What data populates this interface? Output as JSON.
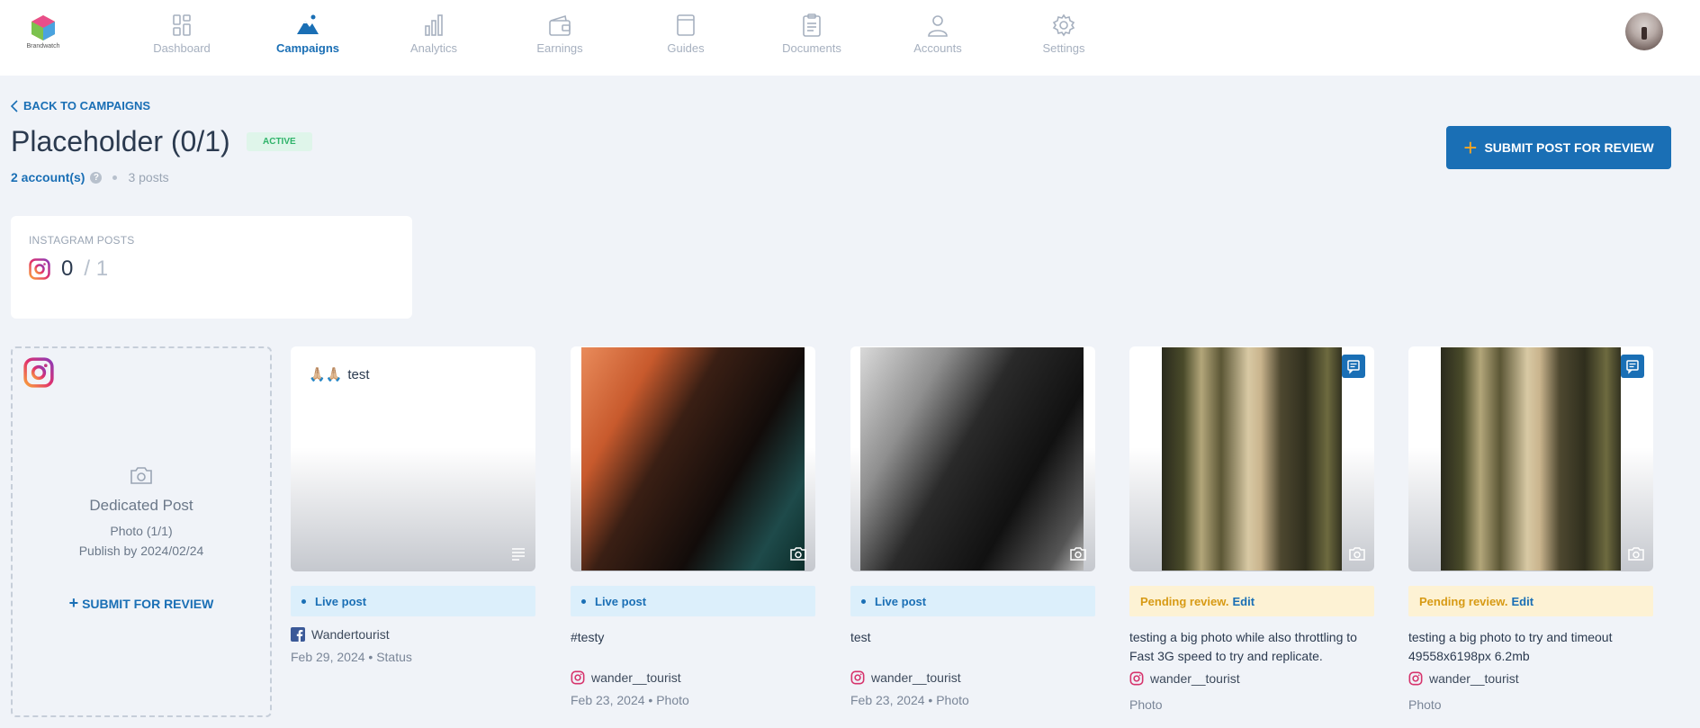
{
  "brand": {
    "logo_text": "Brandwatch"
  },
  "nav": {
    "items": [
      {
        "label": "Dashboard",
        "icon": "dashboard-icon"
      },
      {
        "label": "Campaigns",
        "icon": "mountain-icon",
        "active": true
      },
      {
        "label": "Analytics",
        "icon": "bar-chart-icon"
      },
      {
        "label": "Earnings",
        "icon": "wallet-icon"
      },
      {
        "label": "Guides",
        "icon": "book-icon"
      },
      {
        "label": "Documents",
        "icon": "clipboard-icon"
      },
      {
        "label": "Accounts",
        "icon": "user-icon"
      },
      {
        "label": "Settings",
        "icon": "gear-icon"
      }
    ]
  },
  "header": {
    "back_label": "BACK TO CAMPAIGNS",
    "title": "Placeholder (0/1)",
    "status": "ACTIVE",
    "accounts": "2 account(s)",
    "help": "?",
    "posts_count": "3 posts",
    "submit_label": "SUBMIT POST FOR REVIEW"
  },
  "stats": {
    "label": "INSTAGRAM POSTS",
    "done": "0",
    "total": "/ 1"
  },
  "dedicated": {
    "title": "Dedicated Post",
    "subtitle": "Photo (1/1)",
    "publish_by": "Publish by 2024/02/24",
    "submit_label": "SUBMIT FOR REVIEW"
  },
  "posts": [
    {
      "thumb_text": "test",
      "thumb_emoji": "🙏🏼🙏🏼",
      "status": "Live post",
      "caption": "",
      "account": "Wandertourist",
      "platform": "facebook",
      "date_line": "Feb 29, 2024 • Status"
    },
    {
      "status": "Live post",
      "caption": "#testy",
      "account": "wander__tourist",
      "platform": "instagram",
      "date_line": "Feb 23, 2024 • Photo"
    },
    {
      "status": "Live post",
      "caption": "test",
      "account": "wander__tourist",
      "platform": "instagram",
      "date_line": "Feb 23, 2024 • Photo"
    },
    {
      "status": "Pending review.",
      "edit": "Edit",
      "caption": "testing a big photo while also throttling to Fast 3G speed to try and replicate.",
      "account": "wander__tourist",
      "platform": "instagram",
      "date_line": "Photo"
    },
    {
      "status": "Pending review.",
      "edit": "Edit",
      "caption": "testing a big photo to try and timeout 49558x6198px 6.2mb",
      "account": "wander__tourist",
      "platform": "instagram",
      "date_line": "Photo"
    }
  ],
  "colors": {
    "accent": "#1a6fb5",
    "active_badge_bg": "#dff5ea",
    "active_badge_text": "#2fb36a",
    "pending_bg": "#fdf2d4",
    "pending_text": "#d79a14",
    "live_bg": "#dceffb"
  }
}
